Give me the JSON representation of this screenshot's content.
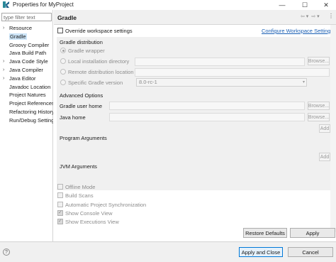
{
  "window": {
    "title": "Properties for MyProject",
    "minimize_glyph": "—",
    "maximize_glyph": "☐",
    "close_glyph": "✕"
  },
  "sidebar": {
    "filter_placeholder": "type filter text",
    "items": [
      {
        "label": "Resource",
        "expandable": true
      },
      {
        "label": "Gradle",
        "expandable": false,
        "selected": true
      },
      {
        "label": "Groovy Compiler",
        "expandable": false
      },
      {
        "label": "Java Build Path",
        "expandable": false
      },
      {
        "label": "Java Code Style",
        "expandable": true
      },
      {
        "label": "Java Compiler",
        "expandable": true
      },
      {
        "label": "Java Editor",
        "expandable": true
      },
      {
        "label": "Javadoc Location",
        "expandable": false
      },
      {
        "label": "Project Natures",
        "expandable": false
      },
      {
        "label": "Project References",
        "expandable": false
      },
      {
        "label": "Refactoring History",
        "expandable": false
      },
      {
        "label": "Run/Debug Settings",
        "expandable": false
      }
    ]
  },
  "page": {
    "title": "Gradle",
    "override_label": "Override workspace settings",
    "configure_link": "Configure Workspace Settings...",
    "distribution": {
      "group_label": "Gradle distribution",
      "options": [
        {
          "label": "Gradle wrapper",
          "selected": true
        },
        {
          "label": "Local installation directory",
          "selected": false
        },
        {
          "label": "Remote distribution location",
          "selected": false
        },
        {
          "label": "Specific Gradle version",
          "selected": false
        }
      ],
      "browse_label": "Browse...",
      "version_value": "8.0-rc-1"
    },
    "advanced": {
      "group_label": "Advanced Options",
      "user_home_label": "Gradle user home",
      "java_home_label": "Java home",
      "browse_label": "Browse...",
      "program_args_label": "Program Arguments",
      "jvm_args_label": "JVM Arguments",
      "add_label": "Add"
    },
    "options": [
      {
        "label": "Offline Mode",
        "checked": false
      },
      {
        "label": "Build Scans",
        "checked": false
      },
      {
        "label": "Automatic Project Synchronization",
        "checked": false
      },
      {
        "label": "Show Console View",
        "checked": true
      },
      {
        "label": "Show Executions View",
        "checked": true
      }
    ],
    "restore_defaults_label": "Restore Defaults",
    "apply_label": "Apply"
  },
  "footer": {
    "apply_close_label": "Apply and Close",
    "cancel_label": "Cancel"
  },
  "colors": {
    "link": "#1a5fb4",
    "selection": "#cce4f7",
    "primary_border": "#0078d7"
  }
}
